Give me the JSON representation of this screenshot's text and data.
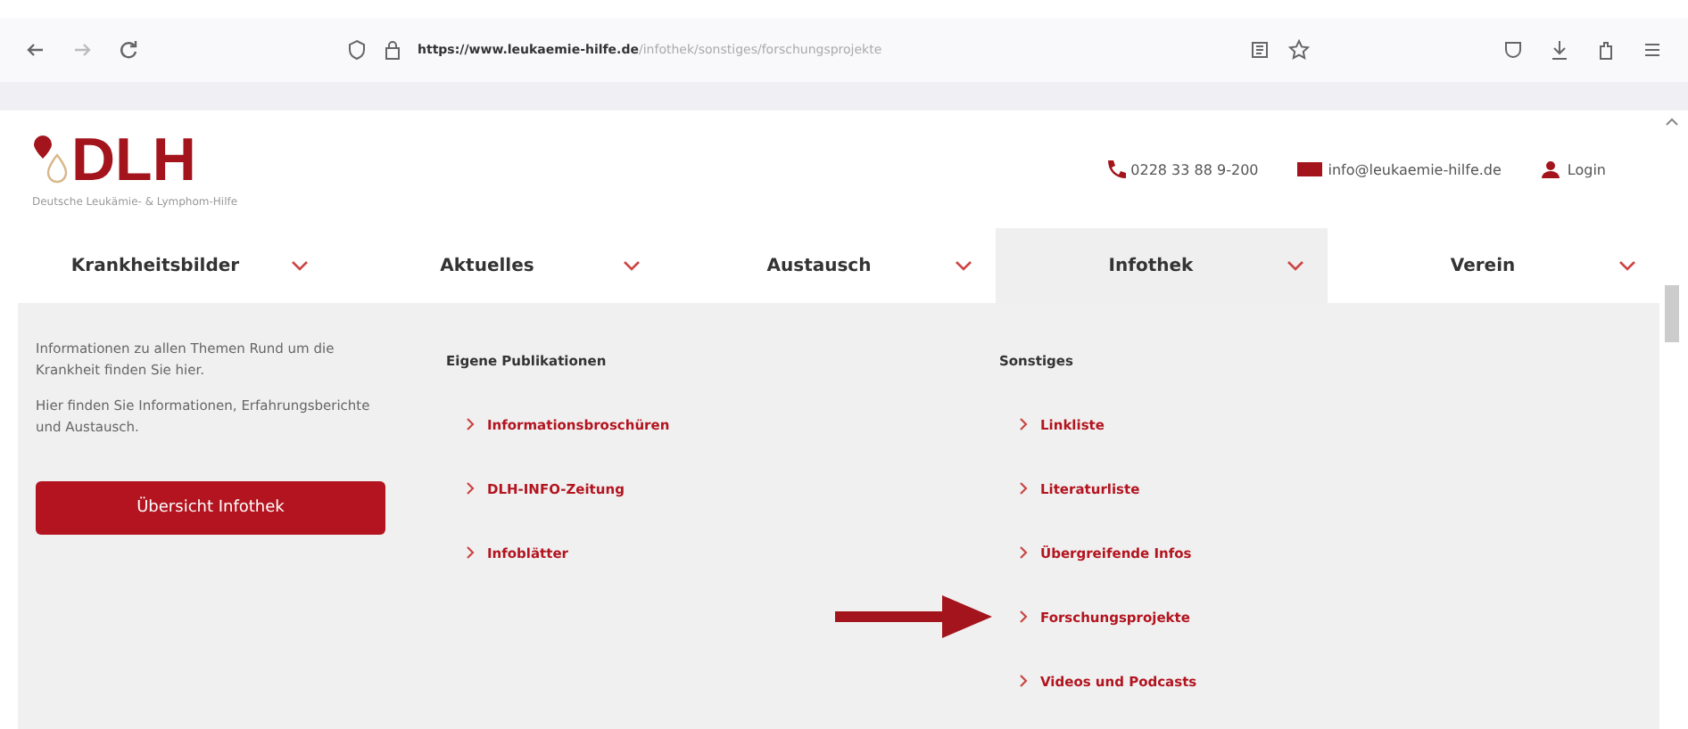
{
  "browser": {
    "url_host": "https://www.leukaemie-hilfe.de",
    "url_path": "/infothek/sonstiges/forschungsprojekte"
  },
  "header": {
    "logo": "DLH",
    "logo_subtitle": "Deutsche Leukämie- & Lymphom-Hilfe",
    "phone": "0228 33 88 9-200",
    "email": "info@leukaemie-hilfe.de",
    "login": "Login"
  },
  "nav": [
    {
      "label": "Krankheitsbilder",
      "selected": false
    },
    {
      "label": "Aktuelles",
      "selected": false
    },
    {
      "label": "Austausch",
      "selected": false
    },
    {
      "label": "Infothek",
      "selected": true
    },
    {
      "label": "Verein",
      "selected": false
    }
  ],
  "panel": {
    "intro": [
      "Informationen zu allen Themen Rund um die Krankheit finden Sie hier.",
      "Hier finden Sie Informationen, Erfahrungsberichte und Austausch."
    ],
    "button": "Übersicht Infothek",
    "columns": [
      {
        "heading": "Eigene Publikationen",
        "links": [
          {
            "label": "Informationsbroschüren",
            "highlighted": false
          },
          {
            "label": "DLH-INFO-Zeitung",
            "highlighted": false
          },
          {
            "label": "Infoblätter",
            "highlighted": false
          }
        ]
      },
      {
        "heading": "Sonstiges",
        "links": [
          {
            "label": "Linkliste",
            "highlighted": false
          },
          {
            "label": "Literaturliste",
            "highlighted": false
          },
          {
            "label": "Übergreifende Infos",
            "highlighted": false
          },
          {
            "label": "Forschungsprojekte",
            "highlighted": true
          },
          {
            "label": "Videos und Podcasts",
            "highlighted": false
          }
        ]
      }
    ]
  }
}
